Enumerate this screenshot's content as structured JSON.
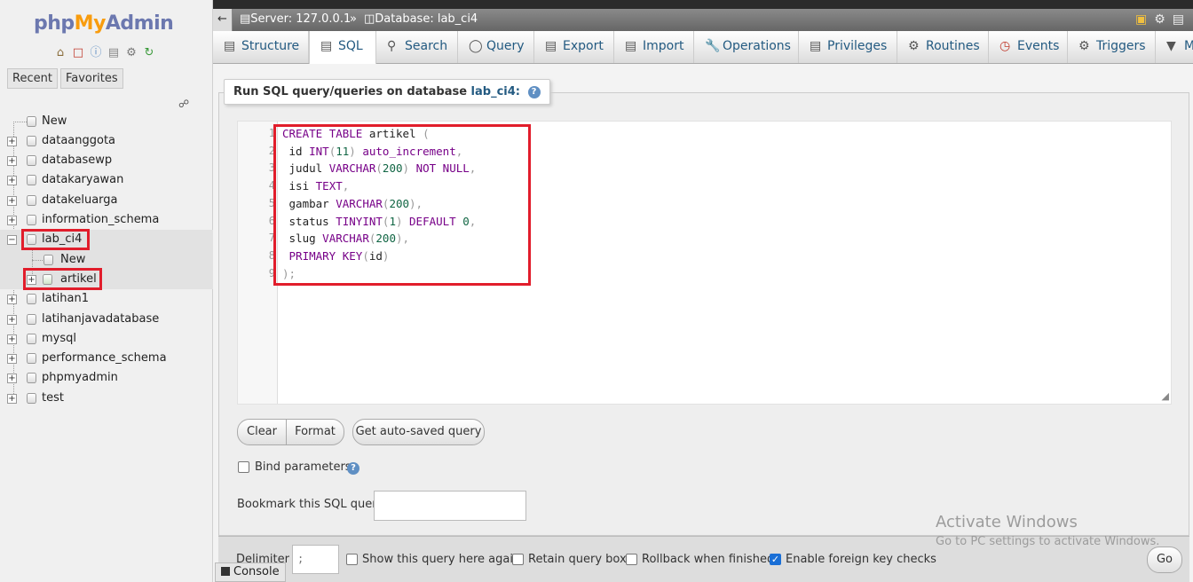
{
  "logo": {
    "php": "php",
    "my": "My",
    "admin": "Admin"
  },
  "nav_tabs": {
    "recent": "Recent",
    "favorites": "Favorites"
  },
  "tree": {
    "new_top": "New",
    "databases": [
      "dataanggota",
      "databasewp",
      "datakaryawan",
      "datakeluarga",
      "information_schema",
      "lab_ci4",
      "latihan1",
      "latihanjavadatabase",
      "mysql",
      "performance_schema",
      "phpmyadmin",
      "test"
    ],
    "lab_ci4_children": {
      "new": "New",
      "table": "artikel"
    }
  },
  "breadcrumb": {
    "server": "Server: 127.0.0.1",
    "separator": "»",
    "database": "Database: lab_ci4"
  },
  "tabs": [
    "Structure",
    "SQL",
    "Search",
    "Query",
    "Export",
    "Import",
    "Operations",
    "Privileges",
    "Routines",
    "Events",
    "Triggers",
    "M"
  ],
  "active_tab": "SQL",
  "legend": {
    "text": "Run SQL query/queries on database ",
    "db": "lab_ci4:"
  },
  "sql_lines": [
    "CREATE TABLE artikel (",
    " id INT(11) auto_increment,",
    " judul VARCHAR(200) NOT NULL,",
    " isi TEXT,",
    " gambar VARCHAR(200),",
    " status TINYINT(1) DEFAULT 0,",
    " slug VARCHAR(200),",
    " PRIMARY KEY(id)",
    ");"
  ],
  "line_numbers": [
    "1",
    "2",
    "3",
    "4",
    "5",
    "6",
    "7",
    "8",
    "9"
  ],
  "buttons": {
    "clear": "Clear",
    "format": "Format",
    "autosaved": "Get auto-saved query",
    "go": "Go"
  },
  "bind_parameters": {
    "label": "Bind parameters",
    "checked": false
  },
  "bookmark": {
    "label": "Bookmark this SQL query:",
    "value": ""
  },
  "delimiter": {
    "label": "Delimiter",
    "value": ";"
  },
  "options": {
    "show_query": {
      "label": "Show this query here again",
      "checked": false
    },
    "retain_box": {
      "label": "Retain query box",
      "checked": false
    },
    "rollback": {
      "label": "Rollback when finished",
      "checked": false
    },
    "foreign_keys": {
      "label": "Enable foreign key checks",
      "checked": true
    }
  },
  "console": "Console",
  "watermark": {
    "title": "Activate Windows",
    "subtitle": "Go to PC settings to activate Windows."
  },
  "colors": {
    "highlight_box": "#e11d2b",
    "link": "#235a81",
    "keyword": "#770088",
    "number": "#116644"
  }
}
